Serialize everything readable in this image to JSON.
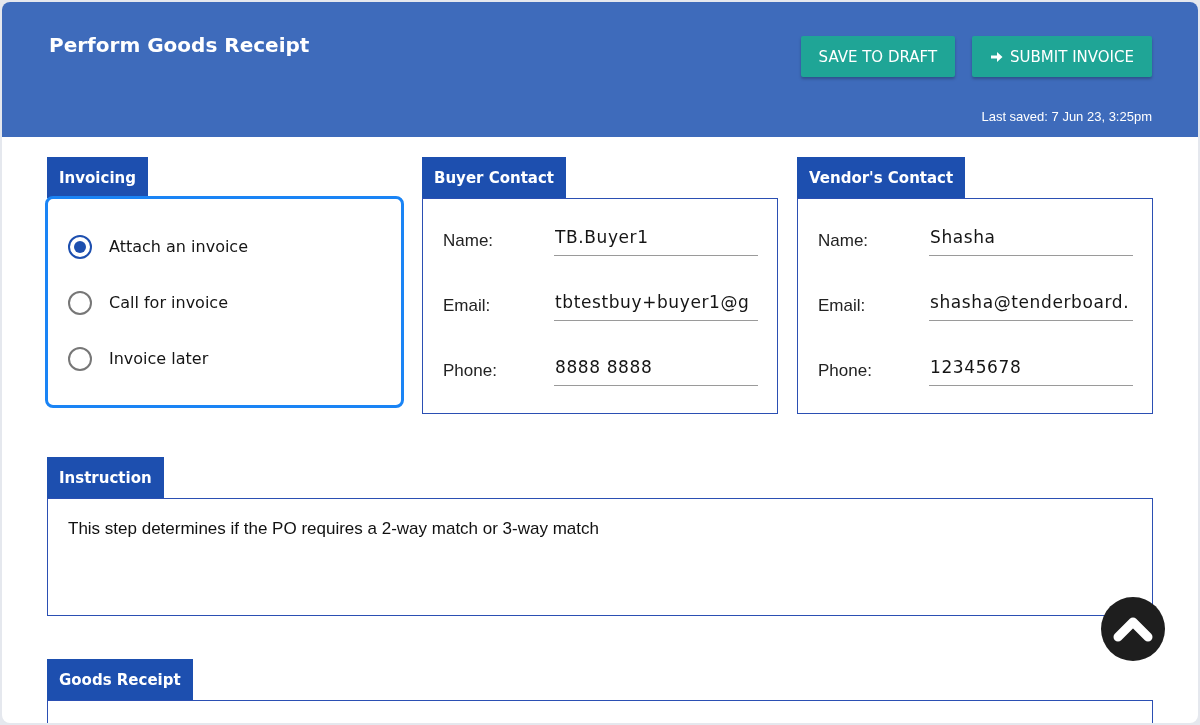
{
  "header": {
    "title": "Perform Goods Receipt",
    "buttons": [
      {
        "label": "SAVE TO DRAFT",
        "kind": "plain"
      },
      {
        "label": "SUBMIT INVOICE",
        "kind": "submit"
      }
    ],
    "last_saved": "Last saved: 7 Jun 23, 3:25pm"
  },
  "invoicing": {
    "title": "Invoicing",
    "focused": true,
    "options": [
      {
        "label": "Attach an invoice",
        "selected": true
      },
      {
        "label": "Call for invoice",
        "selected": false
      },
      {
        "label": "Invoice later",
        "selected": false
      }
    ]
  },
  "buyer_contact": {
    "title": "Buyer Contact",
    "fields": [
      {
        "label": "Name:",
        "value": "TB.Buyer1"
      },
      {
        "label": "Email:",
        "value": "tbtestbuy+buyer1@g"
      },
      {
        "label": "Phone:",
        "value": "8888 8888"
      }
    ]
  },
  "vendor_contact": {
    "title": "Vendor's Contact",
    "fields": [
      {
        "label": "Name:",
        "value": "Shasha"
      },
      {
        "label": "Email:",
        "value": "shasha@tenderboard."
      },
      {
        "label": "Phone:",
        "value": "12345678"
      }
    ]
  },
  "instruction": {
    "title": "Instruction",
    "text": "This step determines if the PO requires a 2-way match or 3-way match"
  },
  "goods_receipt": {
    "title": "Goods Receipt"
  }
}
